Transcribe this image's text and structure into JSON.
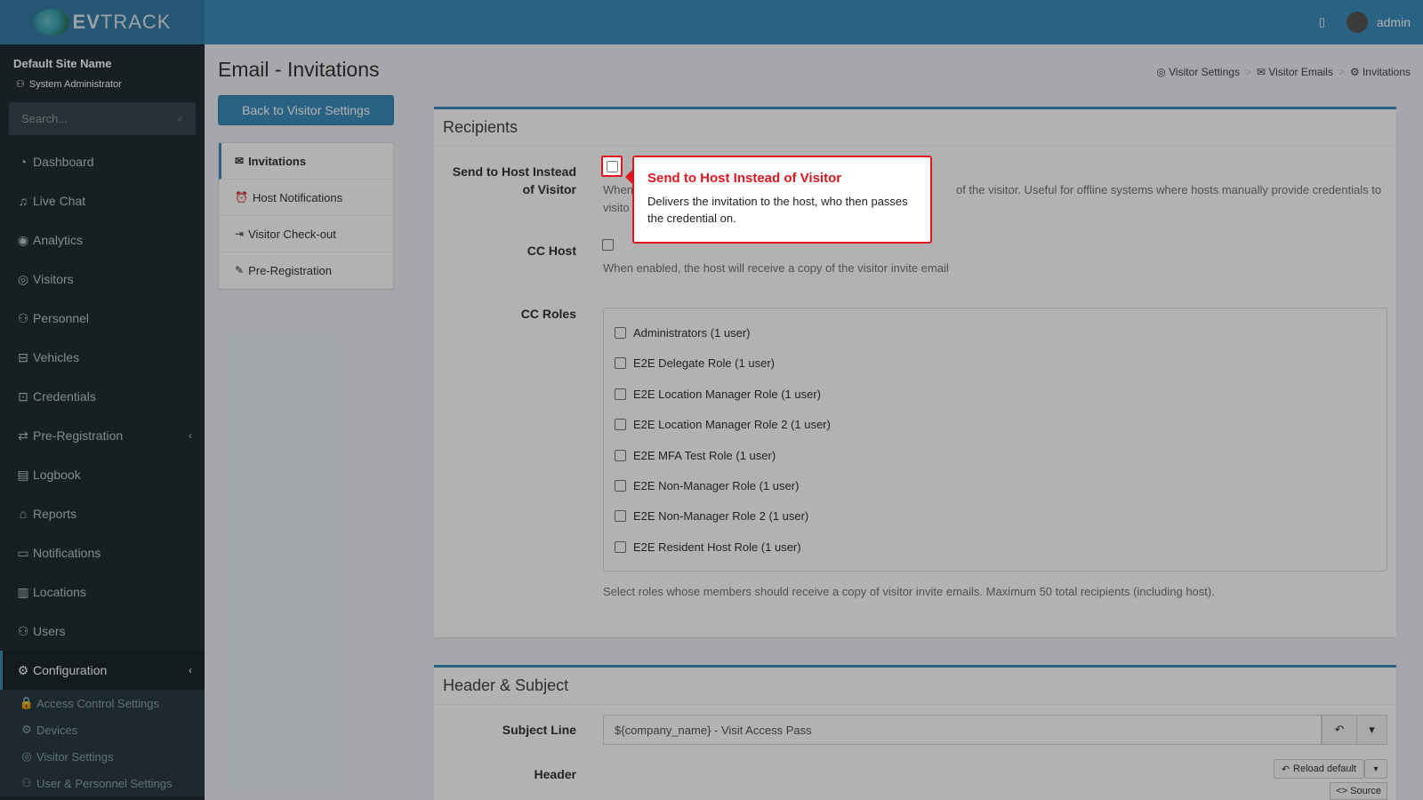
{
  "header": {
    "logo_text_bold": "EV",
    "logo_text_rest": "TRACK",
    "username": "admin",
    "building_icon": "building-icon",
    "avatar_icon": "user-avatar"
  },
  "sidebar": {
    "site_name": "Default Site Name",
    "user_role": "System Administrator",
    "search_placeholder": "Search...",
    "items": [
      {
        "label": "Dashboard",
        "icon": "dashboard-icon",
        "glyph": "◔"
      },
      {
        "label": "Live Chat",
        "icon": "headset-icon",
        "glyph": "♫"
      },
      {
        "label": "Analytics",
        "icon": "analytics-icon",
        "glyph": "◉"
      },
      {
        "label": "Visitors",
        "icon": "eye-icon",
        "glyph": "◎"
      },
      {
        "label": "Personnel",
        "icon": "personnel-icon",
        "glyph": "⚇"
      },
      {
        "label": "Vehicles",
        "icon": "car-icon",
        "glyph": "⊟"
      },
      {
        "label": "Credentials",
        "icon": "badge-icon",
        "glyph": "⊡"
      },
      {
        "label": "Pre-Registration",
        "icon": "swap-icon",
        "glyph": "⇄"
      },
      {
        "label": "Logbook",
        "icon": "book-icon",
        "glyph": "▤"
      },
      {
        "label": "Reports",
        "icon": "reports-icon",
        "glyph": "⌂"
      },
      {
        "label": "Notifications",
        "icon": "chat-icon",
        "glyph": "▭"
      },
      {
        "label": "Locations",
        "icon": "map-icon",
        "glyph": "▥"
      },
      {
        "label": "Users",
        "icon": "users-icon",
        "glyph": "⚇"
      },
      {
        "label": "Configuration",
        "icon": "gear-icon",
        "glyph": "⚙"
      }
    ],
    "sub_items": [
      {
        "label": "Access Control Settings",
        "icon": "lock-icon",
        "glyph": "🔒"
      },
      {
        "label": "Devices",
        "icon": "devices-icon",
        "glyph": "⚙"
      },
      {
        "label": "Visitor Settings",
        "icon": "eye-icon",
        "glyph": "◎"
      },
      {
        "label": "User & Personnel Settings",
        "icon": "users-icon",
        "glyph": "⚇"
      }
    ]
  },
  "page": {
    "title": "Email - Invitations",
    "breadcrumb": [
      {
        "label": "Visitor Settings",
        "icon": "eye-icon",
        "glyph": "◎"
      },
      {
        "label": "Visitor Emails",
        "icon": "mail-icon",
        "glyph": "✉"
      },
      {
        "label": "Invitations",
        "icon": "gear-icon",
        "glyph": "⚙"
      }
    ],
    "back_button": "Back to Visitor Settings",
    "menu": [
      {
        "label": "Invitations",
        "icon": "mail-icon",
        "glyph": "✉"
      },
      {
        "label": "Host Notifications",
        "icon": "alarm-icon",
        "glyph": "⏰"
      },
      {
        "label": "Visitor Check-out",
        "icon": "logout-icon",
        "glyph": "⇥"
      },
      {
        "label": "Pre-Registration",
        "icon": "user-edit-icon",
        "glyph": "✎"
      }
    ]
  },
  "recipients": {
    "title": "Recipients",
    "send_to_host_label": "Send to Host Instead of Visitor",
    "send_to_host_help_start": "When",
    "send_to_host_help_end": "of the visitor. Useful for offline systems where hosts manually provide credentials to",
    "send_to_host_help_line2": "visito",
    "cc_host_label": "CC Host",
    "cc_host_help": "When enabled, the host will receive a copy of the visitor invite email",
    "cc_roles_label": "CC Roles",
    "roles": [
      "Administrators (1 user)",
      "E2E Delegate Role (1 user)",
      "E2E Location Manager Role (1 user)",
      "E2E Location Manager Role 2 (1 user)",
      "E2E MFA Test Role (1 user)",
      "E2E Non-Manager Role (1 user)",
      "E2E Non-Manager Role 2 (1 user)",
      "E2E Resident Host Role (1 user)"
    ],
    "roles_help": "Select roles whose members should receive a copy of visitor invite emails. Maximum 50 total recipients (including host)."
  },
  "header_subject": {
    "title": "Header & Subject",
    "subject_label": "Subject Line",
    "subject_value": "${company_name} - Visit Access Pass",
    "header_label": "Header",
    "reload_default": "Reload default",
    "source": "<> Source"
  },
  "tooltip": {
    "title": "Send to Host Instead of Visitor",
    "body": "Delivers the invitation to the host, who then passes the credential on."
  }
}
